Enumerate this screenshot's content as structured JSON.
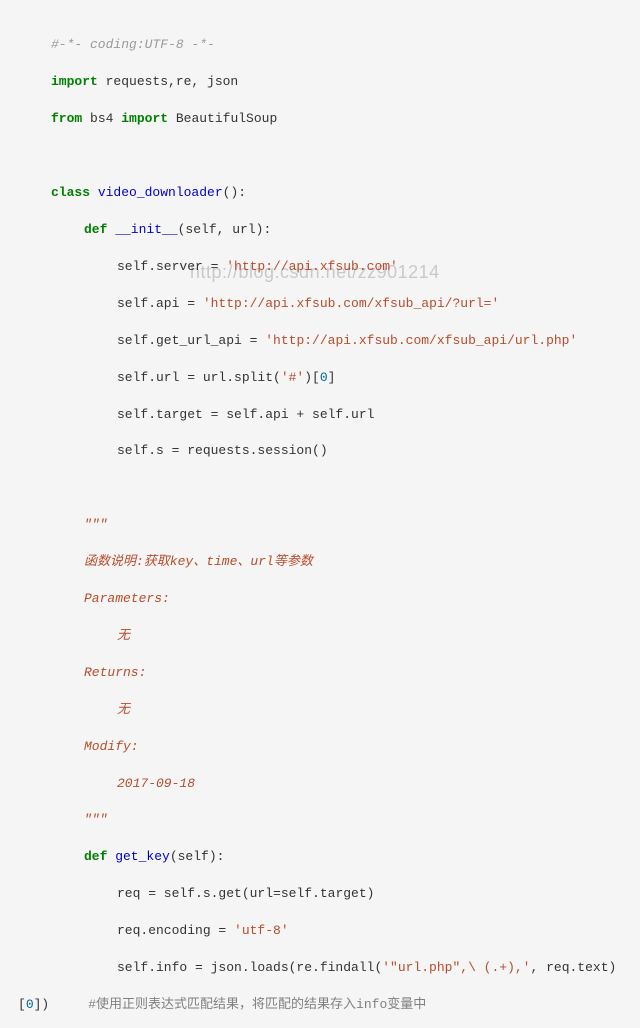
{
  "watermark": "http://blog.csdn.net/zz901214",
  "code": {
    "l01_comment": "#-*- coding:UTF-8 -*-",
    "l02_kw1": "import",
    "l02_rest": " requests,re, json",
    "l03_kw1": "from",
    "l03_mod": " bs4 ",
    "l03_kw2": "import",
    "l03_rest": " BeautifulSoup",
    "l05_kw": "class",
    "l05_name": " video_downloader",
    "l05_rest": "():",
    "l06_kw": "def",
    "l06_name": " __init__",
    "l06_rest": "(self, url):",
    "l07_pre": "self.server = ",
    "l07_str": "'http://api.xfsub.com'",
    "l08_pre": "self.api = ",
    "l08_str": "'http://api.xfsub.com/xfsub_api/?url='",
    "l09_pre": "self.get_url_api = ",
    "l09_str": "'http://api.xfsub.com/xfsub_api/url.php'",
    "l10_pre": "self.url = url.split(",
    "l10_str": "'#'",
    "l10_mid": ")[",
    "l10_num": "0",
    "l10_end": "]",
    "l11": "self.target = self.api + self.url",
    "l12": "self.s = requests.session()",
    "l14_q": "\"\"\"",
    "l15": "函数说明:获取key、time、url等参数",
    "l16": "Parameters:",
    "l17": "无",
    "l18": "Returns:",
    "l19": "无",
    "l20": "Modify:",
    "l21": "2017-09-18",
    "l22_q": "\"\"\"",
    "l23_kw": "def",
    "l23_name": " get_key",
    "l23_rest": "(self):",
    "l24_pre": "req = self.s.get(url",
    "l24_eq": "=",
    "l24_post": "self.target)",
    "l25_pre": "req.encoding = ",
    "l25_str": "'utf-8'",
    "l26_pre": "self.info = json.loads(re.findall(",
    "l26_str": "'\"url.php\",\\ (.+),'",
    "l26_post": ", req.text)",
    "l27_left": "[",
    "l27_num": "0",
    "l27_right": "])",
    "l27_comment": "#使用正则表达式匹配结果，将匹配的结果存入info变量中"
  }
}
